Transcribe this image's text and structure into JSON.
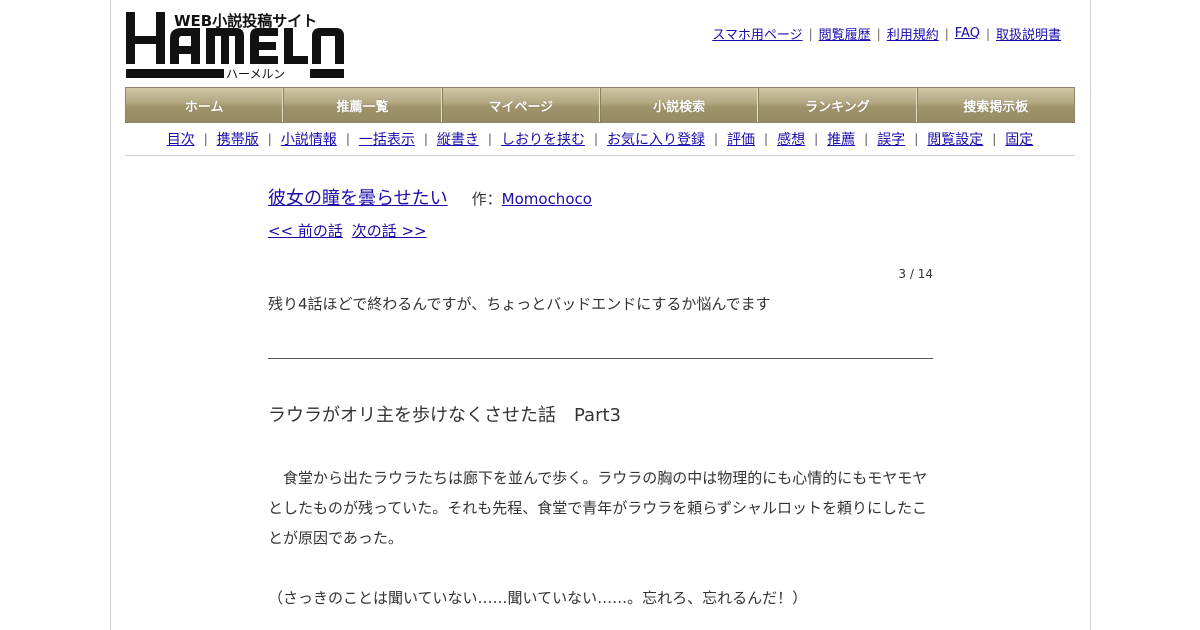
{
  "logo": {
    "brand": "HAMELN",
    "tagline": "WEB小説投稿サイト",
    "kana": "ハーメルン"
  },
  "top_links": [
    "スマホ用ページ",
    "閲覧履歴",
    "利用規約",
    "FAQ",
    "取扱説明書"
  ],
  "main_nav": [
    "ホーム",
    "推薦一覧",
    "マイページ",
    "小説検索",
    "ランキング",
    "捜索掲示板"
  ],
  "sub_nav": [
    "目次",
    "携帯版",
    "小説情報",
    "一括表示",
    "縦書き",
    "しおりを挟む",
    "お気に入り登録",
    "評価",
    "感想",
    "推薦",
    "誤字",
    "閲覧設定",
    "固定"
  ],
  "novel": {
    "title": "彼女の瞳を曇らせたい",
    "author_label": "作：",
    "author": "Momochoco",
    "prev_label": "<< 前の話",
    "next_label": "次の話 >>",
    "page_counter": "3 / 14",
    "preface": "残り4話ほどで終わるんですが、ちょっとバッドエンドにするか悩んでます",
    "chapter_title": "ラウラがオリ主を歩けなくさせた話　Part3",
    "paragraphs": [
      "　食堂から出たラウラたちは廊下を並んで歩く。ラウラの胸の中は物理的にも心情的にもモヤモヤとしたものが残っていた。それも先程、食堂で青年がラウラを頼らずシャルロットを頼りにしたことが原因であった。",
      "（さっきのことは聞いていない……聞いていない……。忘れろ、忘れるんだ！）"
    ]
  }
}
